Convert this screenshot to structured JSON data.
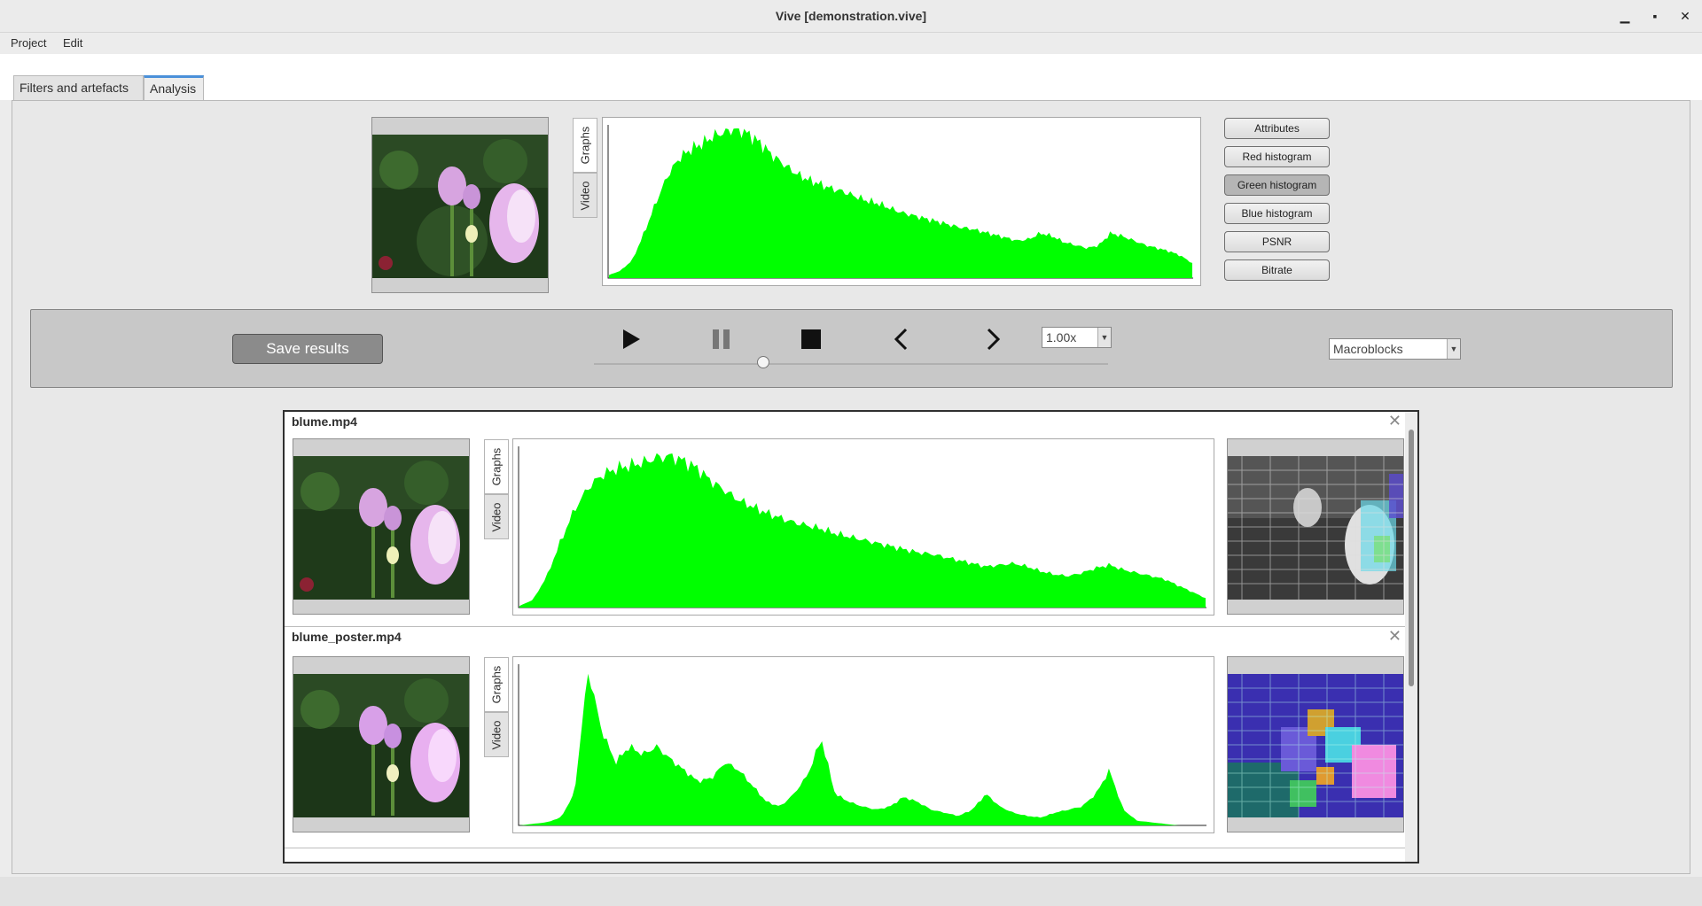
{
  "window": {
    "title": "Vive [demonstration.vive]",
    "minimize_glyph": "▁",
    "maximize_glyph": "▪",
    "close_glyph": "✕"
  },
  "menu": {
    "items": [
      "Project",
      "Edit"
    ]
  },
  "tabs": [
    {
      "label": "Filters and artefacts",
      "active": false
    },
    {
      "label": "Analysis",
      "active": true
    }
  ],
  "source_preview": {
    "graph_tabs": [
      "Graphs",
      "Video"
    ],
    "graph_color": "#00ff00",
    "histogram": [
      0.02,
      0.05,
      0.12,
      0.3,
      0.5,
      0.68,
      0.8,
      0.86,
      0.9,
      0.95,
      0.98,
      1.0,
      0.96,
      0.9,
      0.82,
      0.76,
      0.7,
      0.66,
      0.63,
      0.6,
      0.58,
      0.55,
      0.52,
      0.5,
      0.47,
      0.44,
      0.42,
      0.4,
      0.38,
      0.36,
      0.34,
      0.33,
      0.31,
      0.29,
      0.27,
      0.25,
      0.26,
      0.3,
      0.28,
      0.24,
      0.22,
      0.2,
      0.22,
      0.3,
      0.28,
      0.25,
      0.22,
      0.2,
      0.18,
      0.15,
      0.1
    ]
  },
  "statistic_buttons": [
    {
      "label": "Attributes",
      "active": false
    },
    {
      "label": "Red histogram",
      "active": false
    },
    {
      "label": "Green histogram",
      "active": true
    },
    {
      "label": "Blue histogram",
      "active": false
    },
    {
      "label": "PSNR",
      "active": false
    },
    {
      "label": "Bitrate",
      "active": false
    }
  ],
  "controls": {
    "save_label": "Save results",
    "speed": "1.00x",
    "overlay_mode": "Macroblocks",
    "playback_position": 0.33,
    "play_icon": "play-icon",
    "pause_icon": "pause-icon",
    "stop_icon": "stop-icon",
    "prev_icon": "previous-frame-icon",
    "next_icon": "next-frame-icon"
  },
  "results": [
    {
      "filename": "blume.mp4",
      "graph_tabs": [
        "Graphs",
        "Video"
      ],
      "overlay_kind": "grayscale",
      "histogram": [
        0.01,
        0.05,
        0.2,
        0.42,
        0.62,
        0.76,
        0.84,
        0.88,
        0.9,
        0.92,
        0.95,
        0.96,
        0.93,
        0.88,
        0.8,
        0.74,
        0.68,
        0.64,
        0.6,
        0.57,
        0.54,
        0.52,
        0.5,
        0.47,
        0.45,
        0.43,
        0.41,
        0.39,
        0.37,
        0.35,
        0.34,
        0.32,
        0.3,
        0.28,
        0.26,
        0.27,
        0.28,
        0.26,
        0.23,
        0.21,
        0.2,
        0.22,
        0.25,
        0.27,
        0.24,
        0.22,
        0.2,
        0.18,
        0.14,
        0.1,
        0.06
      ]
    },
    {
      "filename": "blume_poster.mp4",
      "graph_tabs": [
        "Graphs",
        "Video"
      ],
      "overlay_kind": "color",
      "histogram": [
        0.0,
        0.01,
        0.02,
        0.05,
        0.2,
        0.98,
        0.6,
        0.4,
        0.5,
        0.45,
        0.5,
        0.42,
        0.35,
        0.28,
        0.3,
        0.4,
        0.35,
        0.25,
        0.15,
        0.12,
        0.2,
        0.32,
        0.55,
        0.2,
        0.15,
        0.12,
        0.1,
        0.12,
        0.18,
        0.15,
        0.1,
        0.08,
        0.06,
        0.1,
        0.2,
        0.12,
        0.08,
        0.06,
        0.05,
        0.08,
        0.1,
        0.12,
        0.2,
        0.35,
        0.1,
        0.03,
        0.02,
        0.01,
        0.0,
        0.0,
        0.0
      ]
    }
  ]
}
